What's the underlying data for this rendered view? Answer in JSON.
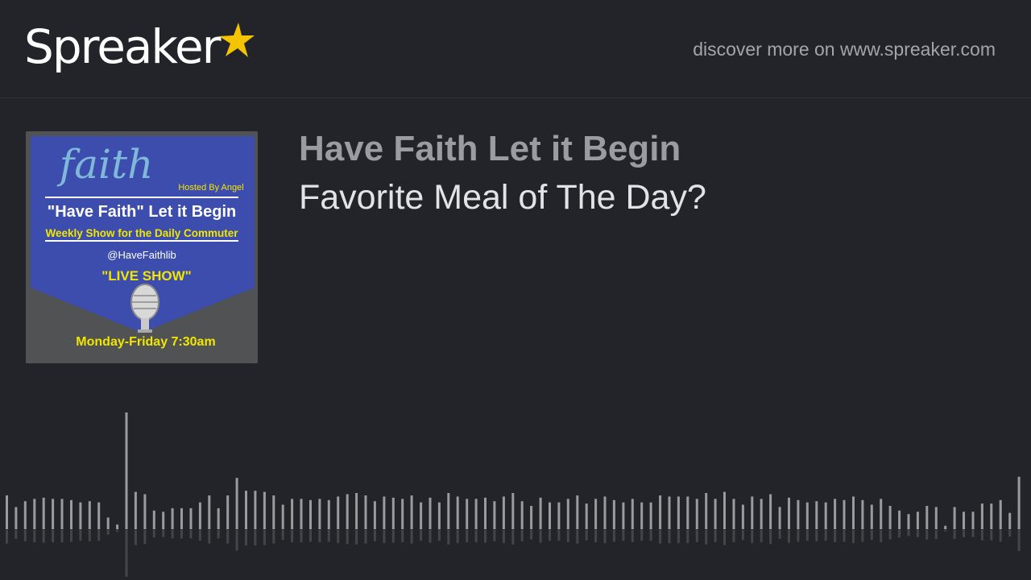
{
  "header": {
    "logo_text": "Spreaker",
    "discover_text": "discover more on www.spreaker.com"
  },
  "cover": {
    "script_title": "faith",
    "hosted_by": "Hosted By Angel",
    "show_line": "\"Have Faith\" Let it Begin",
    "tagline": "Weekly Show for the Daily Commuter",
    "handle": "@HaveFaithlib",
    "live": "\"LIVE SHOW\"",
    "schedule": "Monday-Friday 7:30am"
  },
  "episode": {
    "show_title": "Have Faith Let it Begin",
    "episode_title": "Favorite Meal of The Day?"
  },
  "colors": {
    "background": "#232429",
    "star": "#f5c400",
    "cover_blue": "#3c4dae",
    "cover_yellow": "#f2e600",
    "wave_bar": "#9a9b9f"
  },
  "waveform": {
    "levels": [
      0.29,
      0.19,
      0.24,
      0.26,
      0.27,
      0.26,
      0.26,
      0.25,
      0.23,
      0.24,
      0.23,
      0.1,
      0.04,
      1.0,
      0.32,
      0.3,
      0.16,
      0.15,
      0.18,
      0.18,
      0.18,
      0.23,
      0.29,
      0.18,
      0.29,
      0.44,
      0.33,
      0.33,
      0.32,
      0.29,
      0.21,
      0.26,
      0.26,
      0.25,
      0.26,
      0.25,
      0.28,
      0.3,
      0.31,
      0.29,
      0.24,
      0.28,
      0.27,
      0.26,
      0.29,
      0.23,
      0.27,
      0.23,
      0.31,
      0.28,
      0.26,
      0.26,
      0.27,
      0.24,
      0.28,
      0.31,
      0.24,
      0.2,
      0.27,
      0.23,
      0.23,
      0.26,
      0.29,
      0.22,
      0.26,
      0.28,
      0.25,
      0.23,
      0.26,
      0.23,
      0.23,
      0.29,
      0.28,
      0.28,
      0.28,
      0.26,
      0.31,
      0.26,
      0.32,
      0.26,
      0.21,
      0.28,
      0.26,
      0.3,
      0.19,
      0.27,
      0.25,
      0.23,
      0.24,
      0.23,
      0.26,
      0.25,
      0.28,
      0.25,
      0.21,
      0.26,
      0.2,
      0.16,
      0.13,
      0.15,
      0.2,
      0.19,
      0.03,
      0.19,
      0.15,
      0.15,
      0.22,
      0.22,
      0.25,
      0.14,
      0.45
    ]
  }
}
